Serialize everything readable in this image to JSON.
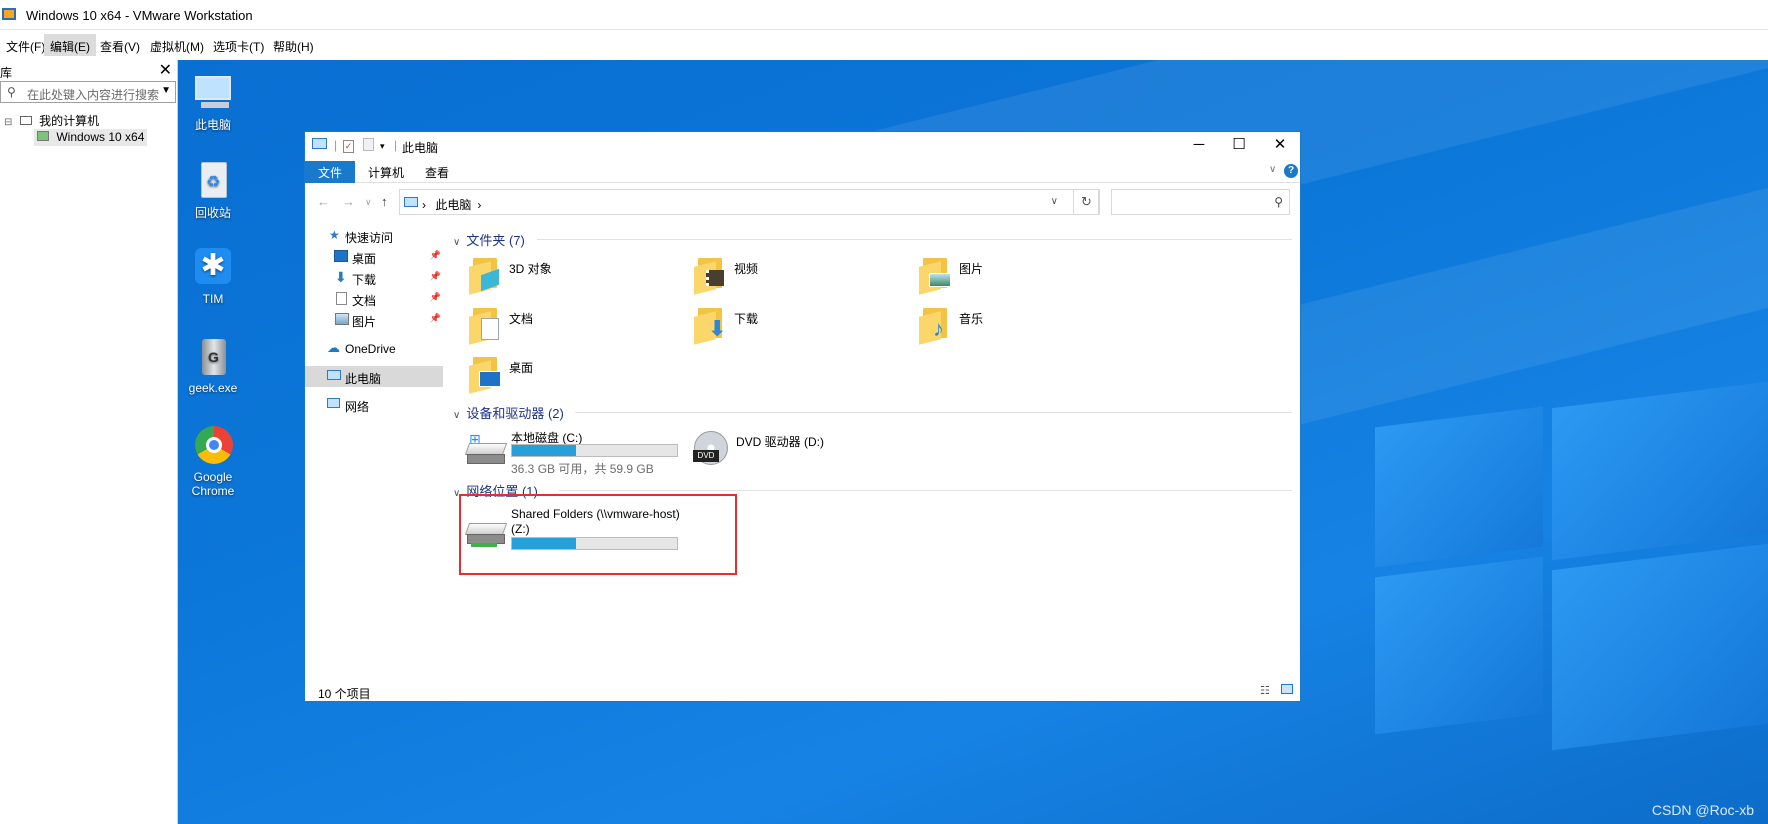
{
  "vmware": {
    "title": "Windows 10 x64 - VMware Workstation",
    "menu": [
      "文件(F)",
      "编辑(E)",
      "查看(V)",
      "虚拟机(M)",
      "选项卡(T)",
      "帮助(H)"
    ],
    "library": {
      "header": "库",
      "search_placeholder": "在此处键入内容进行搜索",
      "tree_root": "我的计算机",
      "tree_child": "Windows 10 x64"
    }
  },
  "desktop": {
    "icons": [
      "此电脑",
      "回收站",
      "TIM",
      "geek.exe",
      "Google Chrome"
    ]
  },
  "explorer": {
    "title": "此电脑",
    "ribbon_tabs": [
      "文件",
      "计算机",
      "查看"
    ],
    "breadcrumb": "此电脑",
    "nav": {
      "quick_access": "快速访问",
      "items": [
        "桌面",
        "下载",
        "文档",
        "图片"
      ],
      "onedrive": "OneDrive",
      "this_pc": "此电脑",
      "network": "网络"
    },
    "groups": {
      "folders_header": "文件夹 (7)",
      "folders": [
        "3D 对象",
        "视频",
        "图片",
        "文档",
        "下载",
        "音乐",
        "桌面"
      ],
      "devices_header": "设备和驱动器 (2)",
      "drive_c": {
        "name": "本地磁盘 (C:)",
        "sub": "36.3 GB 可用，共 59.9 GB",
        "used_fraction": 0.39
      },
      "drive_d": {
        "name": "DVD 驱动器 (D:)"
      },
      "network_header": "网络位置 (1)",
      "drive_z": {
        "name": "Shared Folders (\\\\vmware-host)",
        "name2": "(Z:)",
        "used_fraction": 0.39
      }
    },
    "status": "10 个项目"
  },
  "watermark": "CSDN @Roc-xb",
  "colors": {
    "accent": "#1979ca",
    "desktop": "#0b77d8",
    "highlight": "#e62e2e",
    "bar_fill": "#26a0da"
  }
}
